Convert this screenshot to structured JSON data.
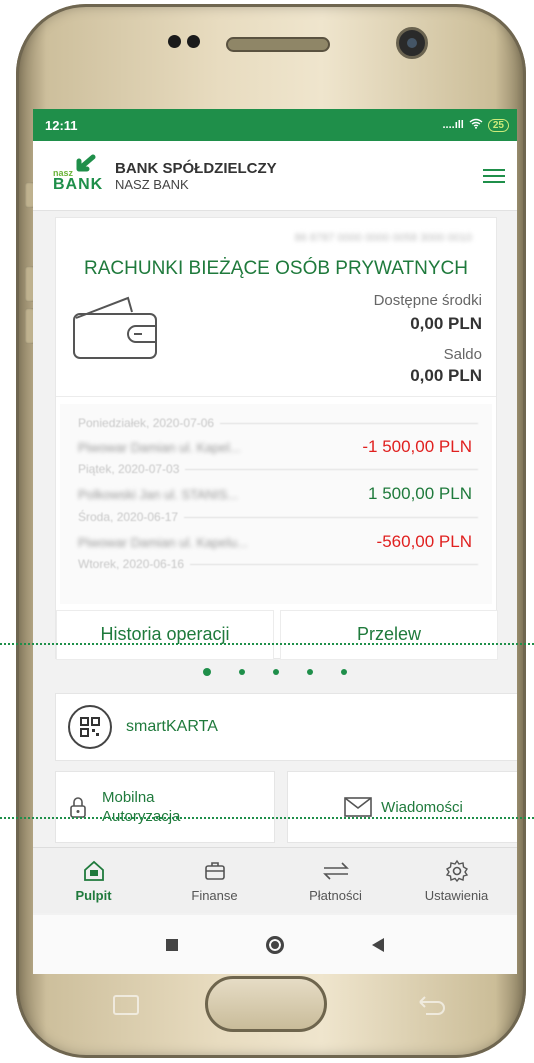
{
  "status": {
    "time": "12:11",
    "signal": "....ıll",
    "battery": "25"
  },
  "brand": {
    "small": "nasz",
    "logo_text": "BANK",
    "title": "BANK SPÓŁDZIELCZY",
    "subtitle": "NASZ BANK"
  },
  "account": {
    "number": "86 8787 0000 0000 0058 3000 0010",
    "name": "RACHUNKI BIEŻĄCE OSÓB PRYWATNYCH",
    "available_label": "Dostępne środki",
    "available_value": "0,00 PLN",
    "balance_label": "Saldo",
    "balance_value": "0,00 PLN"
  },
  "transactions": [
    {
      "date": "Poniedziałek, 2020-07-06",
      "desc": "Piwowar Damian ul. Kapel...",
      "amount": "-1 500,00 PLN",
      "kind": "neg"
    },
    {
      "date": "Piątek, 2020-07-03",
      "desc": "Polkowski Jan ul. STANIS...",
      "amount": "1 500,00 PLN",
      "kind": "pos"
    },
    {
      "date": "Środa, 2020-06-17",
      "desc": "Piwowar Damian ul. Kapelu...",
      "amount": "-560,00 PLN",
      "kind": "neg"
    },
    {
      "date": "Wtorek, 2020-06-16",
      "desc": "",
      "amount": "",
      "kind": ""
    }
  ],
  "card_buttons": {
    "history": "Historia operacji",
    "transfer": "Przelew"
  },
  "pager": {
    "count": 5,
    "active": 0
  },
  "smart": {
    "label": "smartKARTA"
  },
  "tiles": {
    "mobile_line1": "Mobilna",
    "mobile_line2": "Autoryzacja",
    "messages": "Wiadomości"
  },
  "nav": {
    "items": [
      "Pulpit",
      "Finanse",
      "Płatności",
      "Ustawienia"
    ],
    "active": "Pulpit"
  },
  "colors": {
    "primary": "#1f8f4a",
    "accent_text": "#1f7a3c",
    "negative": "#e0201f"
  }
}
